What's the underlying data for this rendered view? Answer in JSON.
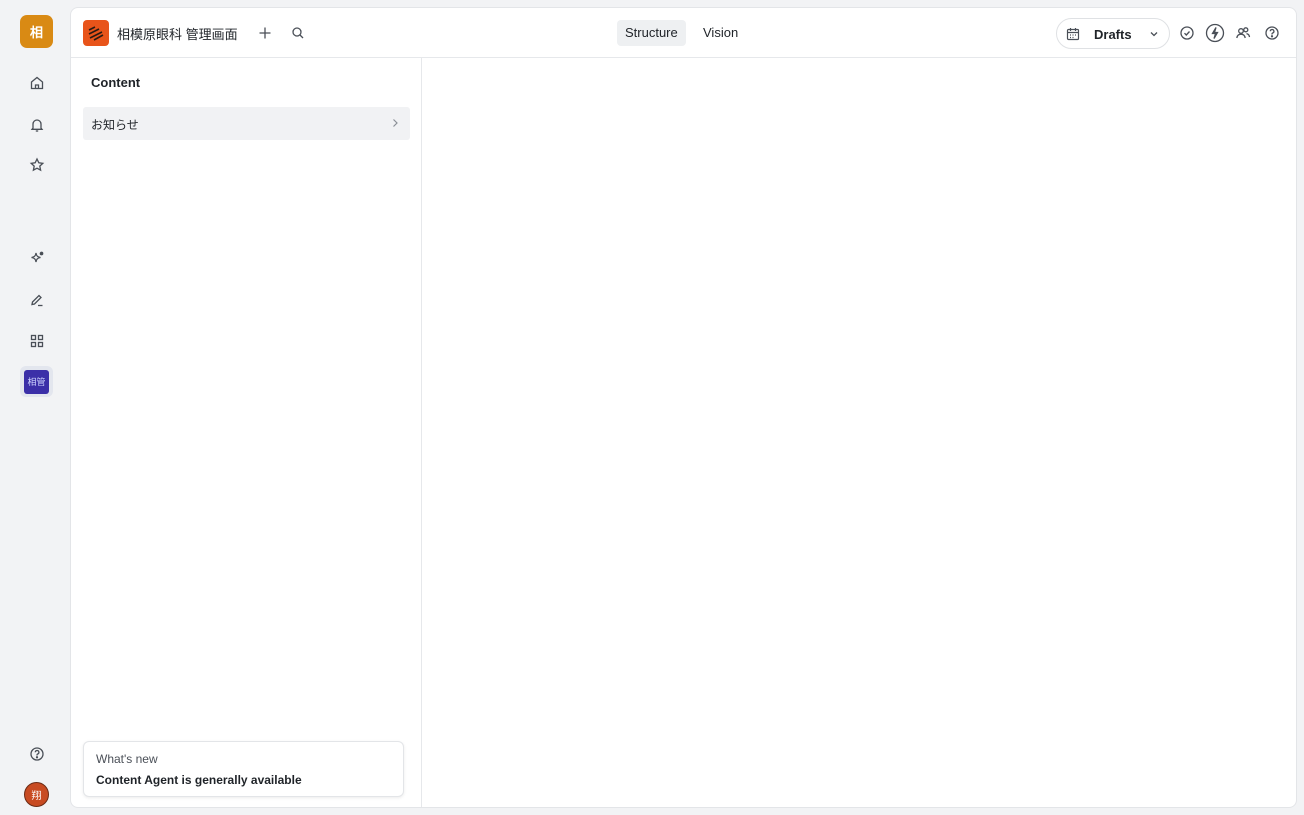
{
  "rail": {
    "org_initial": "相",
    "workspace_tile_label": "相管",
    "user_initial": "翔",
    "icons": [
      "home-icon",
      "bell-icon",
      "star-icon",
      "sparkle-icon",
      "pen-icon",
      "grid-icon",
      "help-icon"
    ]
  },
  "topbar": {
    "workspace_title": "相模原眼科 管理画面",
    "tabs": [
      {
        "label": "Structure",
        "active": true
      },
      {
        "label": "Vision",
        "active": false
      }
    ],
    "release_label": "Drafts"
  },
  "structure": {
    "title": "Content",
    "items": [
      {
        "label": "お知らせ"
      }
    ]
  },
  "whats_new": {
    "eyebrow": "What's new",
    "headline": "Content Agent is generally available"
  }
}
